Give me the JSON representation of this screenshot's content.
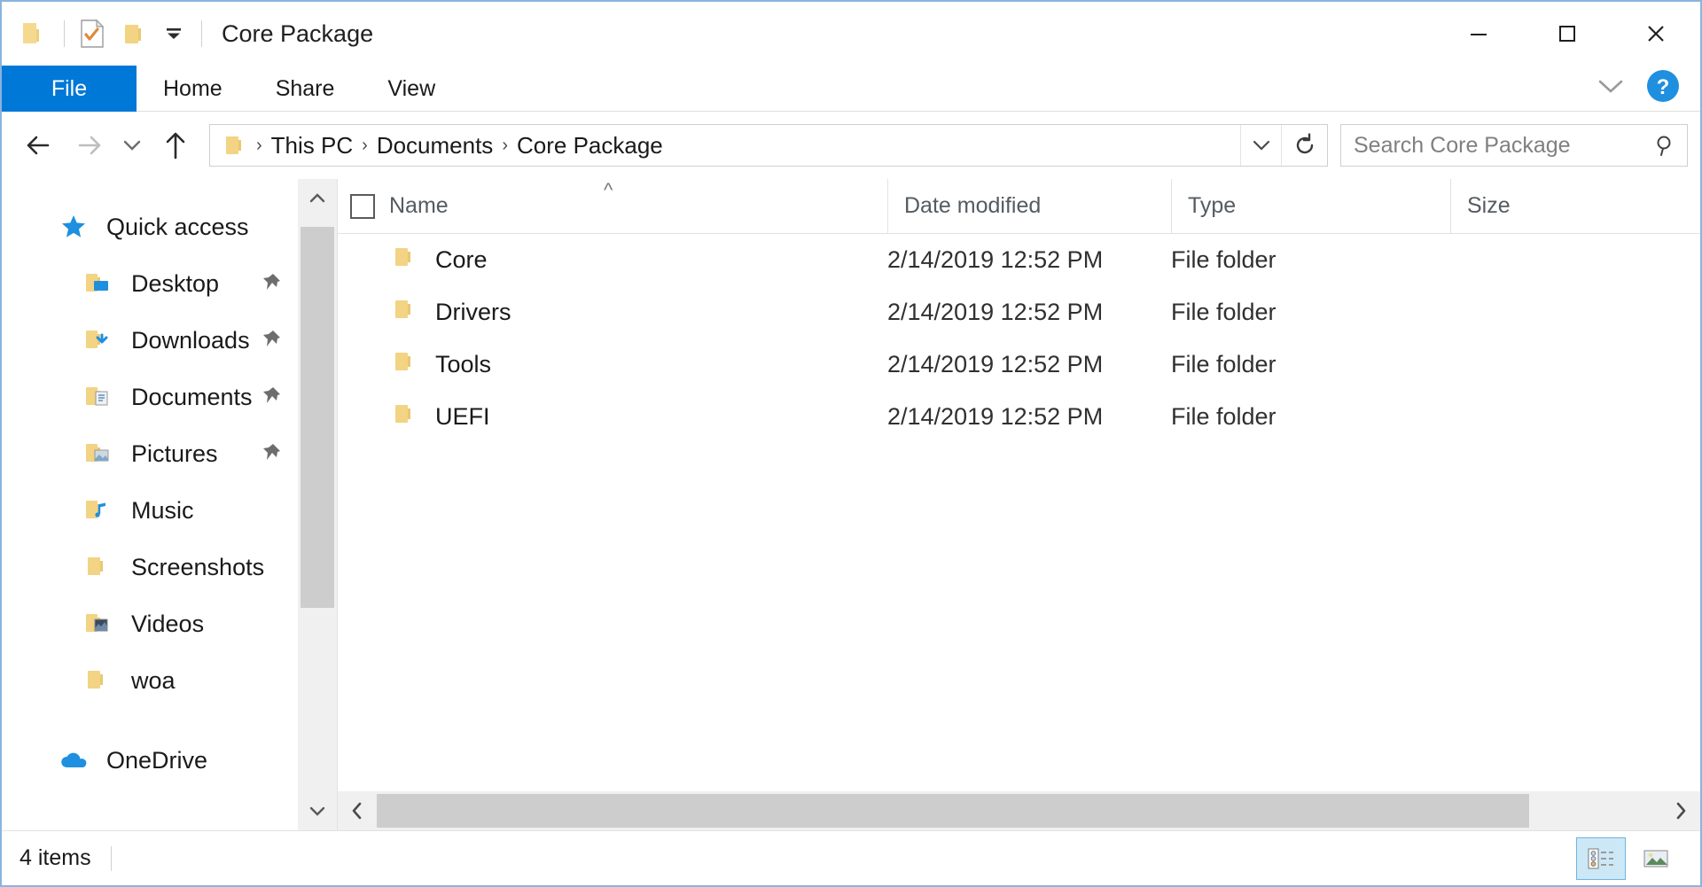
{
  "window": {
    "title": "Core Package",
    "quick_access_toolbar": [
      {
        "name": "folder-icon",
        "label": "Folder"
      },
      {
        "name": "properties-icon",
        "label": "Properties"
      },
      {
        "name": "new-folder-icon",
        "label": "New folder"
      },
      {
        "name": "customize-qat-icon",
        "label": "Customize Quick Access Toolbar"
      }
    ],
    "controls": {
      "minimize": "Minimize",
      "maximize": "Maximize",
      "close": "Close"
    }
  },
  "ribbon": {
    "tabs": [
      {
        "label": "File",
        "active": true
      },
      {
        "label": "Home",
        "active": false
      },
      {
        "label": "Share",
        "active": false
      },
      {
        "label": "View",
        "active": false
      }
    ],
    "expand_label": "Expand the Ribbon",
    "help_label": "Help"
  },
  "addressbar": {
    "back": "Back",
    "forward": "Forward",
    "recent": "Recent locations",
    "up": "Up",
    "breadcrumbs": [
      "This PC",
      "Documents",
      "Core Package"
    ],
    "separator": "›",
    "dropdown": "Previous locations",
    "refresh": "Refresh"
  },
  "search": {
    "placeholder": "Search Core Package",
    "value": "",
    "icon": "search-icon"
  },
  "sidebar": {
    "items": [
      {
        "label": "Quick access",
        "icon": "star-icon",
        "level": "root",
        "pinned": false
      },
      {
        "label": "Desktop",
        "icon": "desktop-folder-icon",
        "level": "child",
        "pinned": true
      },
      {
        "label": "Downloads",
        "icon": "downloads-folder-icon",
        "level": "child",
        "pinned": true
      },
      {
        "label": "Documents",
        "icon": "documents-folder-icon",
        "level": "child",
        "pinned": true
      },
      {
        "label": "Pictures",
        "icon": "pictures-folder-icon",
        "level": "child",
        "pinned": true
      },
      {
        "label": "Music",
        "icon": "music-folder-icon",
        "level": "child",
        "pinned": false
      },
      {
        "label": "Screenshots",
        "icon": "folder-icon",
        "level": "child",
        "pinned": false
      },
      {
        "label": "Videos",
        "icon": "videos-folder-icon",
        "level": "child",
        "pinned": false
      },
      {
        "label": "woa",
        "icon": "folder-icon",
        "level": "child",
        "pinned": false
      },
      {
        "label": "OneDrive",
        "icon": "onedrive-cloud-icon",
        "level": "root",
        "pinned": false
      }
    ]
  },
  "filelist": {
    "columns": [
      {
        "label": "Name",
        "sorted": "asc"
      },
      {
        "label": "Date modified",
        "sorted": ""
      },
      {
        "label": "Type",
        "sorted": ""
      },
      {
        "label": "Size",
        "sorted": ""
      }
    ],
    "rows": [
      {
        "name": "Core",
        "date": "2/14/2019 12:52 PM",
        "type": "File folder",
        "size": ""
      },
      {
        "name": "Drivers",
        "date": "2/14/2019 12:52 PM",
        "type": "File folder",
        "size": ""
      },
      {
        "name": "Tools",
        "date": "2/14/2019 12:52 PM",
        "type": "File folder",
        "size": ""
      },
      {
        "name": "UEFI",
        "date": "2/14/2019 12:52 PM",
        "type": "File folder",
        "size": ""
      }
    ]
  },
  "statusbar": {
    "item_count": "4 items",
    "views": [
      {
        "name": "details-view-button",
        "label": "Details view",
        "active": true
      },
      {
        "name": "large-icons-view-button",
        "label": "Large icons view",
        "active": false
      }
    ]
  },
  "colors": {
    "accent": "#0078d7",
    "folder": "#f8d775",
    "selection": "#cce8f7",
    "window_border": "#8ab4dd"
  }
}
